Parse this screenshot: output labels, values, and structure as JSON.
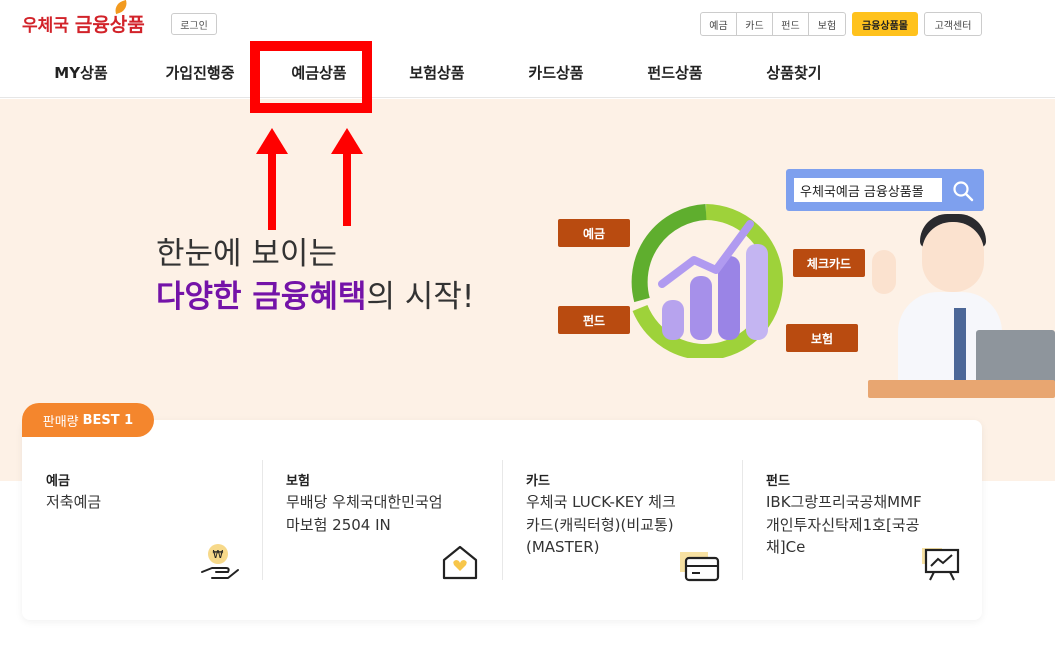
{
  "header": {
    "logo_prefix": "우체국",
    "logo_main": "금융상품",
    "login_label": "로그인",
    "quick_links": [
      "예금",
      "카드",
      "펀드",
      "보험"
    ],
    "mall_label": "금융상품몰",
    "customer_center_label": "고객센터"
  },
  "nav": {
    "items": [
      "MY상품",
      "가입진행중",
      "예금상품",
      "보험상품",
      "카드상품",
      "펀드상품",
      "상품찾기"
    ]
  },
  "hero": {
    "line1": "한눈에 보이는",
    "line2_highlight": "다양한 금융혜택",
    "line2_rest": "의 시작!",
    "search_text": "우체국예금 금융상품몰",
    "tags": {
      "deposit": "예금",
      "fund": "펀드",
      "check_card": "체크카드",
      "insurance": "보험"
    }
  },
  "best": {
    "badge_prefix": "판매량",
    "badge_bold": "BEST 1",
    "items": [
      {
        "category": "예금",
        "name": "저축예금"
      },
      {
        "category": "보험",
        "name": "무배당 우체국대한민국엄마보험 2504 IN"
      },
      {
        "category": "카드",
        "name": "우체국 LUCK-KEY 체크카드(캐릭터형)(비교통)(MASTER)"
      },
      {
        "category": "펀드",
        "name": "IBK그랑프리국공채MMF개인투자신탁제1호[국공채]Ce"
      }
    ]
  },
  "colors": {
    "brand_red": "#d2232a",
    "accent_yellow": "#ffc21d",
    "badge_orange": "#f4862d",
    "tag_brown": "#b94b10",
    "highlight_purple": "#7413a8",
    "annotation_red": "#ff0000"
  }
}
